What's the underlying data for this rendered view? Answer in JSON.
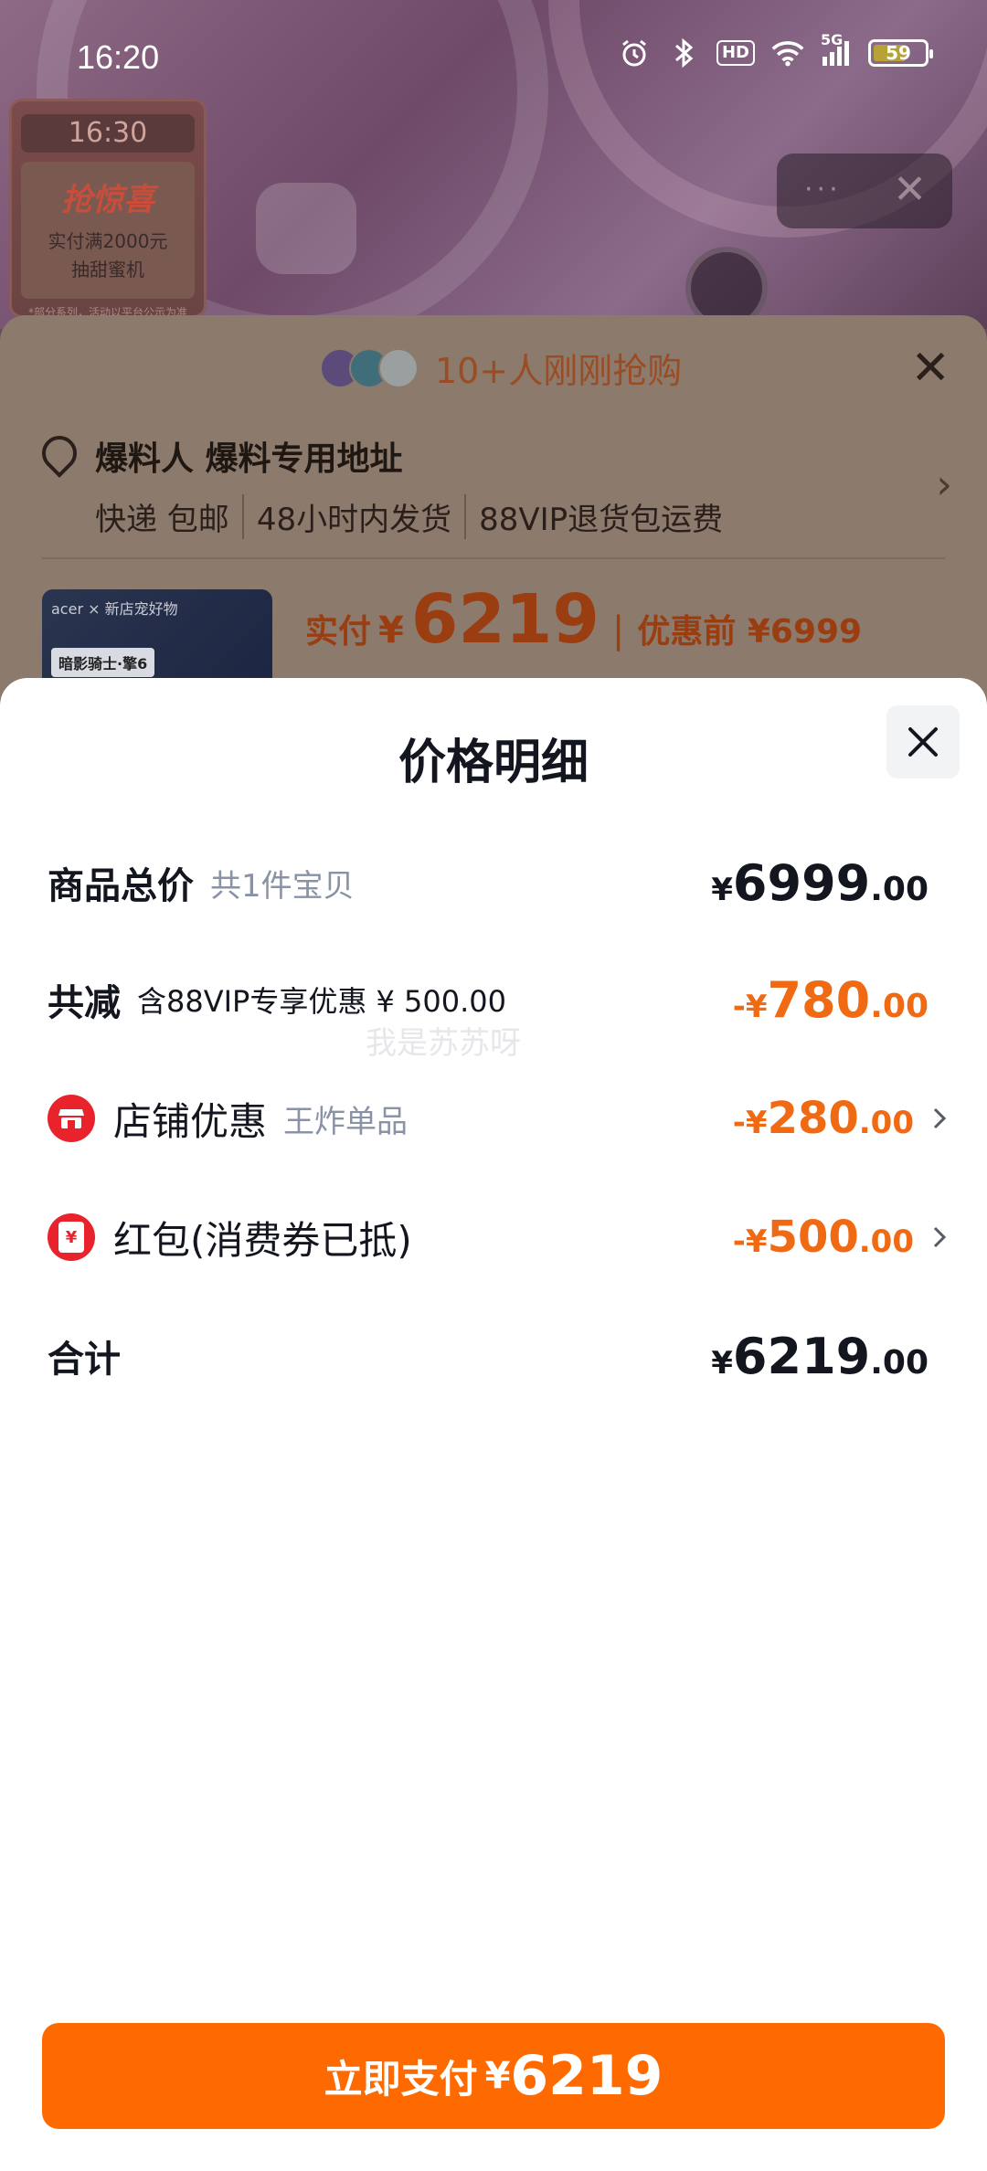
{
  "status_bar": {
    "time": "16:20",
    "hd_label": "HD",
    "network_label": "5G",
    "battery_level": "59"
  },
  "background": {
    "promo": {
      "time": "16:30",
      "title": "抢惊喜",
      "line1": "实付满2000元",
      "line2": "抽甜蜜机",
      "fine_print": "*部分系列，活动以平台公示为准"
    },
    "more_label": "···",
    "close_label": "✕"
  },
  "order_sheet": {
    "buyers_text": "10+人刚刚抢购",
    "address_title": "爆料人 爆料专用地址",
    "tags": [
      "快递 包邮",
      "48小时内发货",
      "88VIP退货包运费"
    ],
    "product_brand": "acer × 新店宠好物",
    "product_badge": "暗影骑士·擎6",
    "actual_label": "实付",
    "currency": "¥",
    "actual_price": "6219",
    "before_label": "优惠前 ¥6999"
  },
  "price_detail": {
    "title": "价格明细",
    "rows": {
      "total": {
        "label": "商品总价",
        "note": "共1件宝贝",
        "currency": "¥",
        "int": "6999",
        "dec": ".00"
      },
      "discount": {
        "label": "共减",
        "desc": "含88VIP专享优惠 ¥ 500.00",
        "currency": "-¥",
        "int": "780",
        "dec": ".00"
      },
      "store": {
        "label": "店铺优惠",
        "note": "王炸单品",
        "currency": "-¥",
        "int": "280",
        "dec": ".00"
      },
      "redpacket": {
        "label": "红包(消费券已抵)",
        "currency": "-¥",
        "int": "500",
        "dec": ".00",
        "icon_char": "¥"
      },
      "sum": {
        "label": "合计",
        "currency": "¥",
        "int": "6219",
        "dec": ".00"
      }
    },
    "watermark": "我是苏苏呀"
  },
  "pay_button": {
    "label": "立即支付",
    "currency": "¥",
    "amount": "6219"
  },
  "colors": {
    "accent_orange": "#ff6a00",
    "discount_orange": "#f06a14",
    "icon_red": "#e8232c",
    "text_dark": "#13161f",
    "text_muted": "#8a93a6"
  }
}
